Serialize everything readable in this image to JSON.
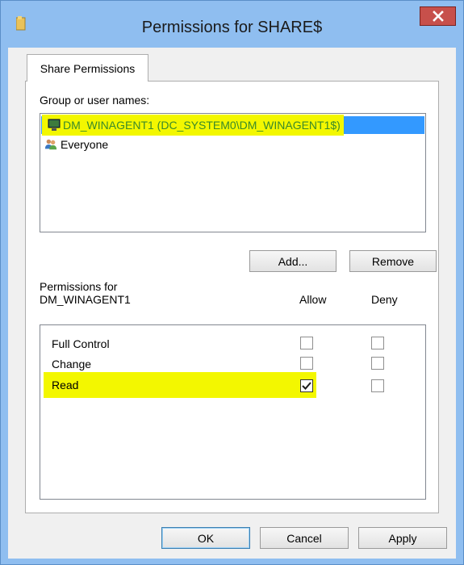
{
  "window": {
    "title": "Permissions for SHARE$",
    "close_glyph": "X"
  },
  "tabs": [
    {
      "label": "Share Permissions"
    }
  ],
  "group_section": {
    "label": "Group or user names:",
    "items": [
      {
        "label": "DM_WINAGENT1 (DC_SYSTEM0\\DM_WINAGENT1$)",
        "icon": "computer-icon",
        "selected": true,
        "highlighted": true
      },
      {
        "label": "Everyone",
        "icon": "users-icon",
        "selected": false
      }
    ],
    "add_button": "Add...",
    "remove_button": "Remove"
  },
  "permissions_section": {
    "label_line1": "Permissions for",
    "label_line2": "DM_WINAGENT1",
    "allow_header": "Allow",
    "deny_header": "Deny",
    "rows": [
      {
        "name": "Full Control",
        "allow": false,
        "deny": false
      },
      {
        "name": "Change",
        "allow": false,
        "deny": false
      },
      {
        "name": "Read",
        "allow": true,
        "deny": false,
        "highlighted": true
      }
    ]
  },
  "footer": {
    "ok": "OK",
    "cancel": "Cancel",
    "apply": "Apply"
  },
  "colors": {
    "frame": "#8fbef0",
    "close_button": "#c7504b",
    "selection": "#3399ff",
    "annotation_highlight": "#f3f700"
  }
}
